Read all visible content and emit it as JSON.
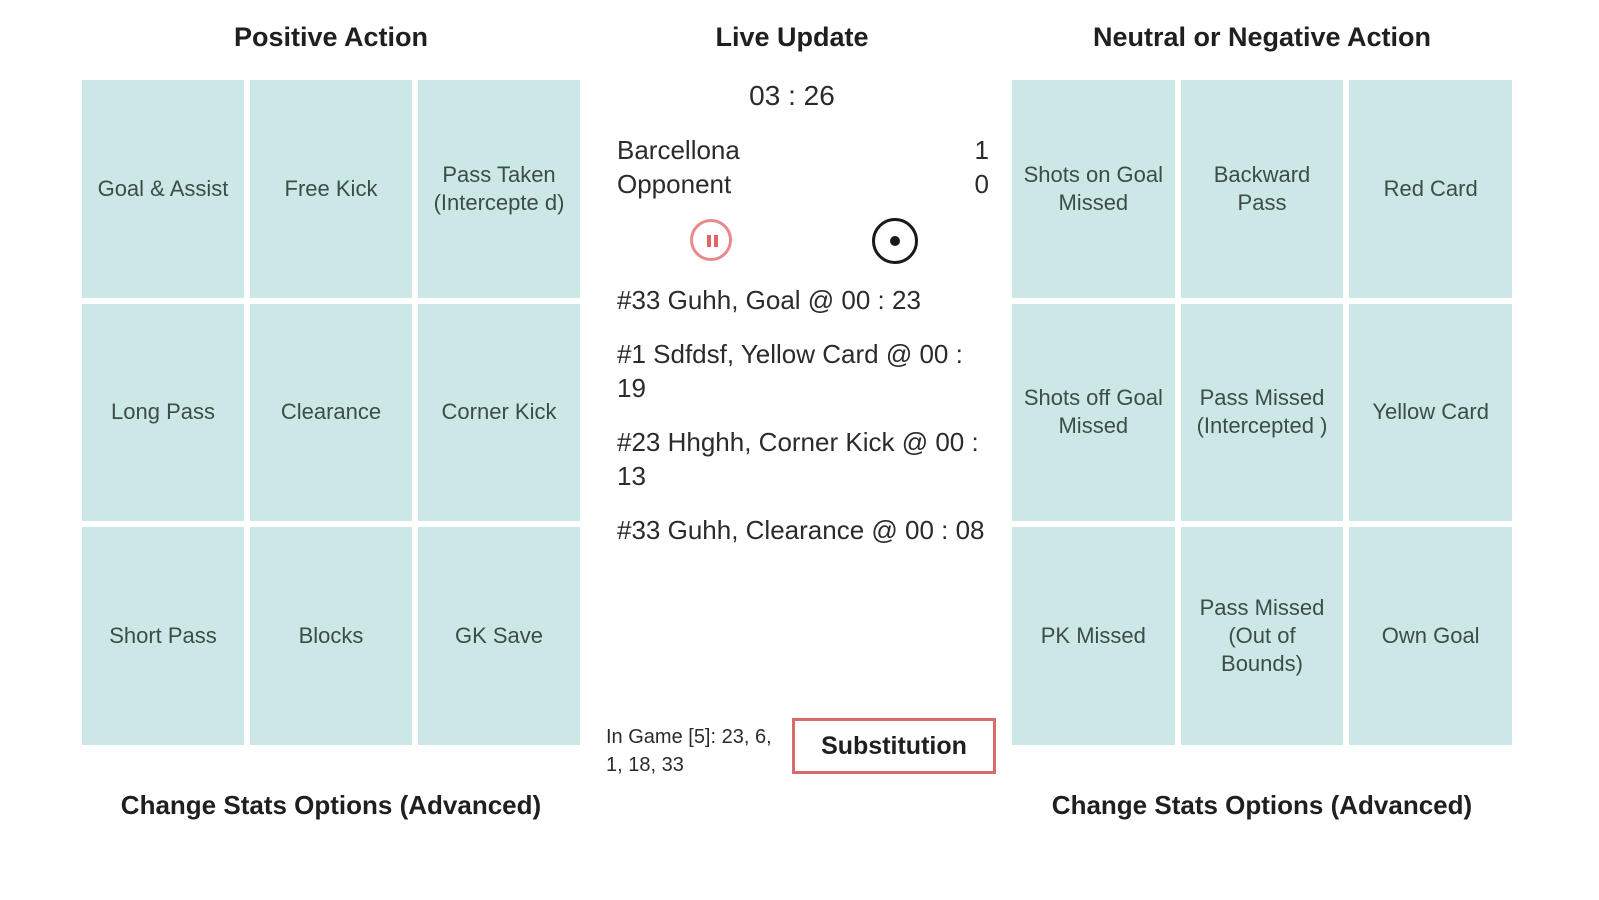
{
  "positive": {
    "title": "Positive Action",
    "buttons": [
      "Goal & Assist",
      "Free Kick",
      "Pass Taken (Intercepte d)",
      "Long Pass",
      "Clearance",
      "Corner Kick",
      "Short Pass",
      "Blocks",
      "GK Save"
    ],
    "advanced_label": "Change Stats Options (Advanced)"
  },
  "live": {
    "title": "Live Update",
    "timer": "03 : 26",
    "home": {
      "name": "Barcellona",
      "score": "1"
    },
    "away": {
      "name": "Opponent",
      "score": "0"
    },
    "feed": [
      "#33 Guhh, Goal @ 00 : 23",
      "#1 Sdfdsf, Yellow Card @ 00 : 19",
      "#23 Hhghh, Corner Kick @ 00 : 13",
      "#33 Guhh, Clearance @ 00 : 08"
    ],
    "in_game": "In Game [5]: 23, 6, 1, 18, 33",
    "substitution_label": "Substitution",
    "pause_icon": "pause-icon",
    "record_icon": "record-icon"
  },
  "negative": {
    "title": "Neutral or Negative Action",
    "buttons": [
      "Shots on Goal Missed",
      "Backward Pass",
      "Red Card",
      "Shots off Goal Missed",
      "Pass Missed (Intercepted )",
      "Yellow Card",
      "PK Missed",
      "Pass Missed (Out of Bounds)",
      "Own Goal"
    ],
    "advanced_label": "Change Stats Options (Advanced)"
  },
  "colors": {
    "tile": "#cbe8e7",
    "accent_red": "#d96b6b"
  }
}
